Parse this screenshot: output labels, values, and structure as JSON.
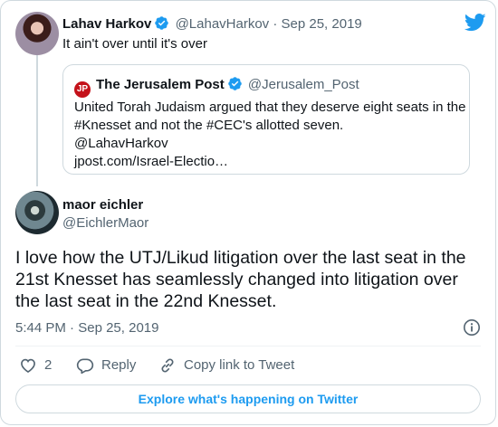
{
  "parent_tweet": {
    "name": "Lahav Harkov",
    "handle": "@LahavHarkov",
    "separator": "·",
    "date": "Sep 25, 2019",
    "text": "It ain't over until it's over"
  },
  "quoted_tweet": {
    "name": "The Jerusalem Post",
    "handle": "@Jerusalem_Post",
    "logo_text": "JP",
    "lines": [
      "United Torah Judaism argued that they deserve eight seats in the",
      "#Knesset and not the #CEC's allotted seven.",
      "@LahavHarkov",
      "jpost.com/Israel-Electio…"
    ]
  },
  "main_tweet": {
    "name": "maor eichler",
    "handle": "@EichlerMaor",
    "text_lines": [
      "I love how the UTJ/Likud litigation over the last seat in the",
      "21st Knesset has seamlessly changed into litigation over",
      "the last seat in the 22nd Knesset."
    ],
    "time": "5:44 PM",
    "separator": "·",
    "date": "Sep 25, 2019"
  },
  "actions": {
    "like_count": "2",
    "reply_label": "Reply",
    "copy_link_label": "Copy link to Tweet"
  },
  "explore_label": "Explore what's happening on Twitter",
  "icons": {
    "brand": "twitter-bird-icon",
    "verified": "verified-badge-icon",
    "info": "info-icon",
    "like": "heart-icon",
    "reply": "reply-bubble-icon",
    "copy": "link-icon"
  },
  "colors": {
    "accent": "#1d9bf0",
    "text": "#0f1419",
    "muted": "#536471",
    "border": "#cfd9de",
    "jpost_red": "#c4121a"
  }
}
